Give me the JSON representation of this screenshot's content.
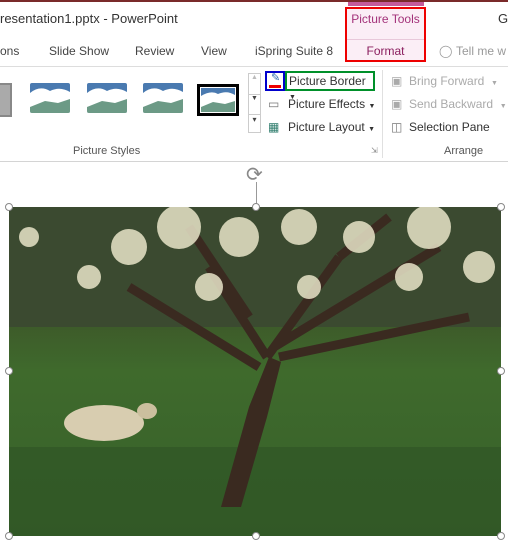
{
  "title": "resentation1.pptx  -  PowerPoint",
  "user_initial": "G",
  "context_tab": {
    "group": "Picture Tools",
    "tab": "Format",
    "color": "#a3327a"
  },
  "tabs": [
    "ons",
    "Slide Show",
    "Review",
    "View",
    "iSpring Suite 8"
  ],
  "tell_me": "Tell me w",
  "picture_styles": {
    "label": "Picture Styles"
  },
  "picture_buttons": {
    "border": "Picture Border",
    "effects": "Picture Effects",
    "layout": "Picture Layout"
  },
  "arrange": {
    "label": "Arrange",
    "bring_forward": "Bring Forward",
    "send_backward": "Send Backward",
    "selection_pane": "Selection Pane"
  },
  "highlights": {
    "context_tab": "#e00000",
    "border_icon": "#0000cc",
    "border_button": "#00902a"
  }
}
